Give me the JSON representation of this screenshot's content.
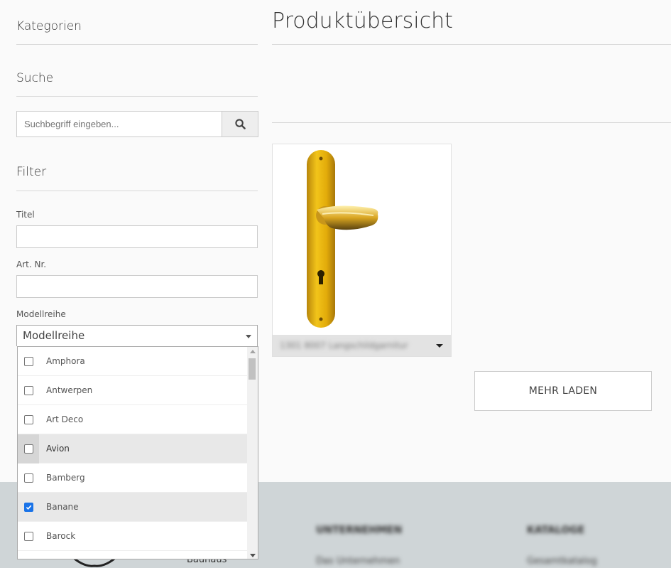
{
  "sidebar": {
    "categories_heading": "Kategorien",
    "search_heading": "Suche",
    "search_placeholder": "Suchbegriff eingeben...",
    "filter_heading": "Filter",
    "title_label": "Titel",
    "artnr_label": "Art. Nr.",
    "series_label": "Modellreihe",
    "series_select": "Modellreihe",
    "series_options": [
      {
        "label": "Amphora",
        "checked": false
      },
      {
        "label": "Antwerpen",
        "checked": false
      },
      {
        "label": "Art Deco",
        "checked": false
      },
      {
        "label": "Avion",
        "checked": false
      },
      {
        "label": "Bamberg",
        "checked": false
      },
      {
        "label": "Banane",
        "checked": true
      },
      {
        "label": "Barock",
        "checked": false
      }
    ]
  },
  "main": {
    "page_title": "Produktübersicht",
    "product": {
      "title": "1301 8007 Langschildgarnitur"
    },
    "more_button": "MEHR LADEN"
  },
  "footer": {
    "col1_heading": "UNTERNEHMEN",
    "col1_link": "Das Unternehmen",
    "col2_heading": "KATALOGE",
    "col2_link": "Gesamtkatalog",
    "brand_text": "Bauhaus"
  },
  "colors": {
    "checkbox_accent": "#1a73e8",
    "footer_bg": "#cfd5d7"
  }
}
